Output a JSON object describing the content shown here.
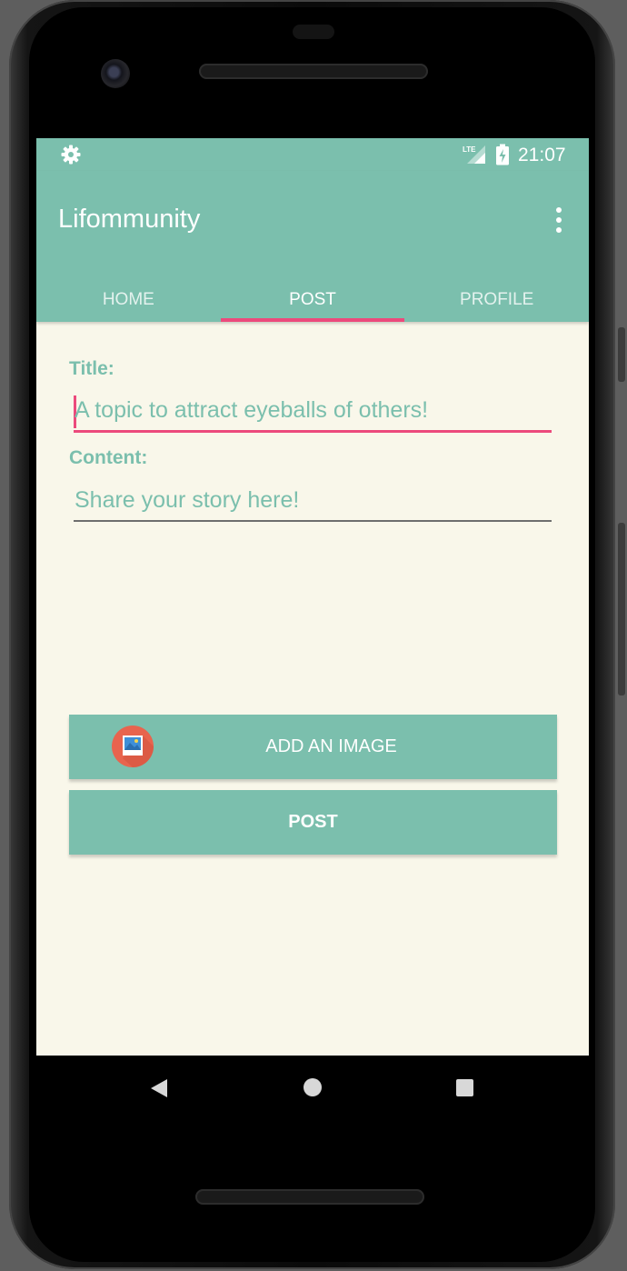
{
  "status_bar": {
    "time": "21:07",
    "network": "LTE",
    "icons": [
      "settings-icon",
      "lte-signal-icon",
      "battery-charging-icon"
    ]
  },
  "app_bar": {
    "title": "Lifommunity",
    "menu_icon": "more-vert-icon"
  },
  "tabs": [
    {
      "label": "HOME",
      "active": false
    },
    {
      "label": "POST",
      "active": true
    },
    {
      "label": "PROFILE",
      "active": false
    }
  ],
  "form": {
    "title_label": "Title:",
    "title_placeholder": "A topic to attract eyeballs of others!",
    "content_label": "Content:",
    "content_placeholder": "Share your story here!"
  },
  "buttons": {
    "add_image_label": "ADD AN IMAGE",
    "add_image_icon": "image-icon",
    "post_label": "POST"
  },
  "nav_bar": {
    "icons": [
      "back-icon",
      "home-icon",
      "recents-icon"
    ]
  },
  "colors": {
    "accent": "#7bbfad",
    "highlight": "#ec4a7c",
    "background": "#f9f7ea"
  }
}
